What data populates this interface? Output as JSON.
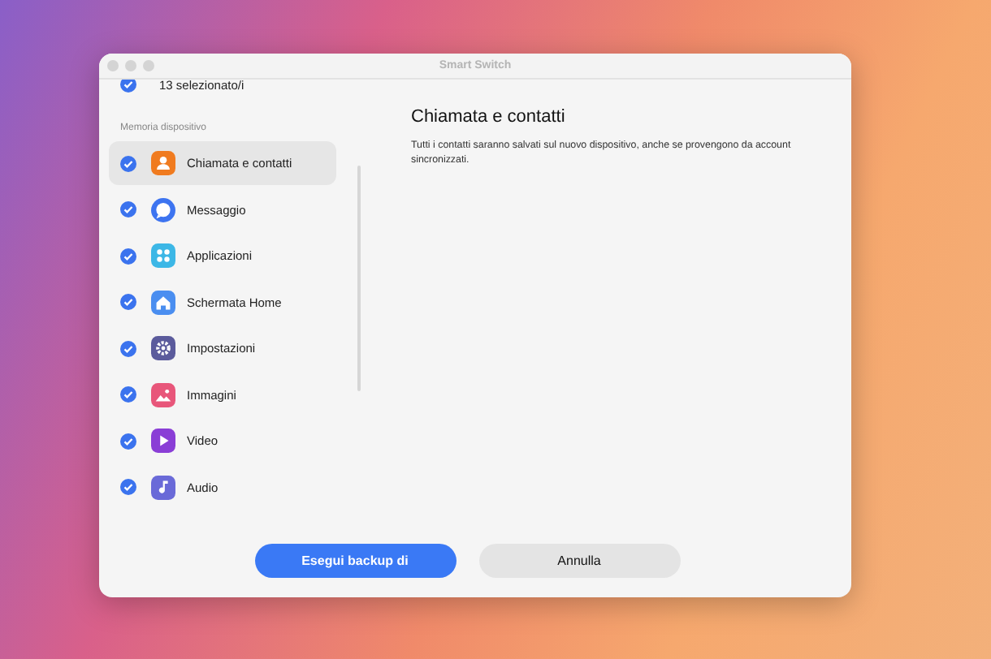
{
  "window": {
    "title": "Smart Switch"
  },
  "selection": {
    "label": "13 selezionato/i",
    "checked": true
  },
  "sidebar": {
    "section": "Memoria dispositivo",
    "items": [
      {
        "label": "Chiamata e contatti",
        "checked": true,
        "selected": true
      },
      {
        "label": "Messaggio",
        "checked": true,
        "selected": false
      },
      {
        "label": "Applicazioni",
        "checked": true,
        "selected": false
      },
      {
        "label": "Schermata Home",
        "checked": true,
        "selected": false
      },
      {
        "label": "Impostazioni",
        "checked": true,
        "selected": false
      },
      {
        "label": "Immagini",
        "checked": true,
        "selected": false
      },
      {
        "label": "Video",
        "checked": true,
        "selected": false
      },
      {
        "label": "Audio",
        "checked": true,
        "selected": false
      }
    ]
  },
  "detail": {
    "title": "Chiamata e contatti",
    "description": "Tutti i contatti saranno salvati sul nuovo dispositivo, anche se provengono da account sincronizzati."
  },
  "buttons": [
    {
      "label": "Esegui backup di",
      "kind": "primary"
    },
    {
      "label": "Annulla",
      "kind": "secondary"
    }
  ]
}
